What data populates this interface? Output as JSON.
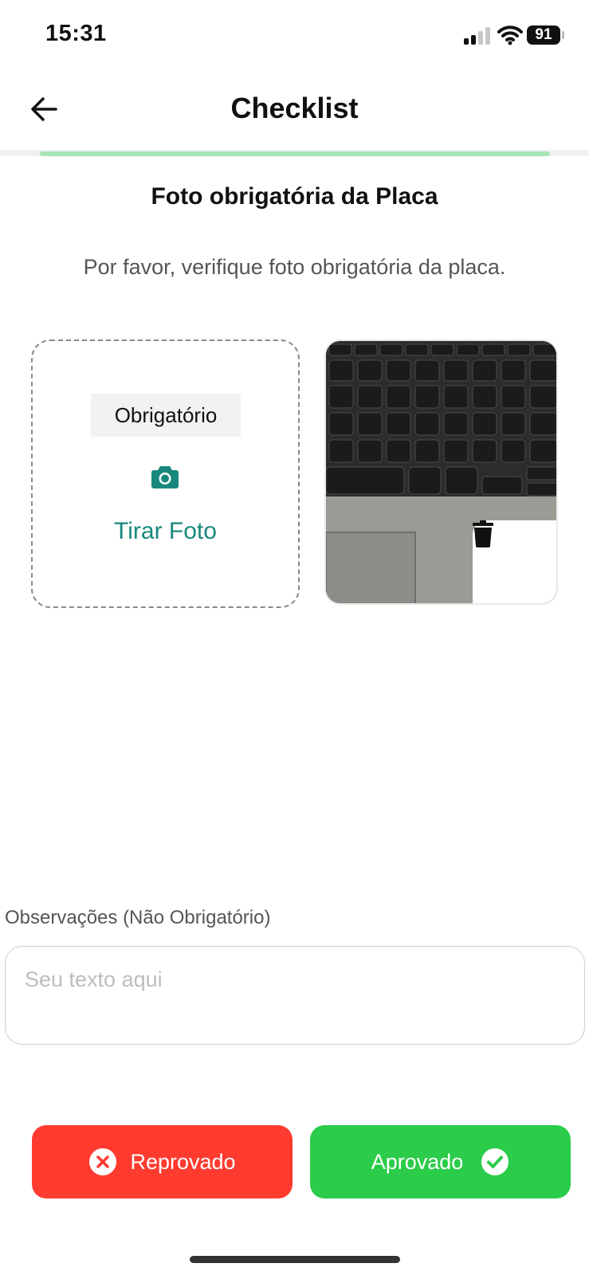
{
  "status_bar": {
    "time": "15:31",
    "battery": "91"
  },
  "header": {
    "title": "Checklist",
    "progress": 1.0
  },
  "section": {
    "title": "Foto obrigatória da Placa",
    "description": "Por favor, verifique foto obrigatória da placa."
  },
  "photo_slot": {
    "badge": "Obrigatório",
    "action_label": "Tirar Foto"
  },
  "observations": {
    "label": "Observações (Não Obrigatório)",
    "placeholder": "Seu texto aqui",
    "value": ""
  },
  "actions": {
    "reject_label": "Reprovado",
    "approve_label": "Aprovado"
  },
  "colors": {
    "accent": "#17897c",
    "reject": "#ff3b30",
    "approve": "#2bcc4a",
    "progress": "#a8e4b5"
  },
  "icons": [
    "back-arrow-icon",
    "camera-icon",
    "trash-icon",
    "close-circle-icon",
    "check-circle-icon",
    "wifi-icon",
    "signal-icon",
    "battery-icon"
  ]
}
